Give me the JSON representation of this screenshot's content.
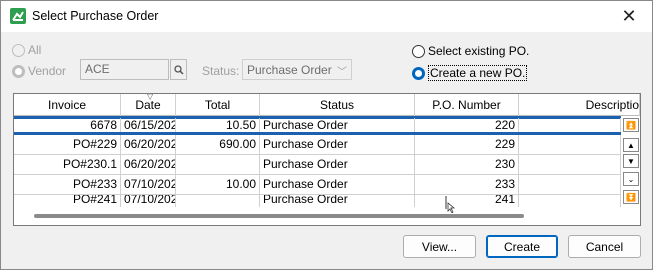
{
  "window": {
    "title": "Select Purchase Order",
    "close_glyph": "✕"
  },
  "filters": {
    "all_label": "All",
    "vendor_label": "Vendor",
    "vendor_value": "ACE",
    "status_label": "Status:",
    "status_value": "Purchase Order"
  },
  "mode": {
    "existing_label": "Select existing PO.",
    "create_label": "Create a new PO.",
    "selected": "create"
  },
  "table": {
    "columns": [
      "Invoice",
      "Date",
      "Total",
      "Status",
      "P.O. Number",
      "Descriptio"
    ],
    "rows": [
      {
        "invoice": "6678",
        "date": "06/15/202",
        "total": "10.50",
        "status": "Purchase Order",
        "po": "220"
      },
      {
        "invoice": "PO#229",
        "date": "06/20/202",
        "total": "690.00",
        "status": "Purchase Order",
        "po": "229"
      },
      {
        "invoice": "PO#230.1",
        "date": "06/20/202",
        "total": "",
        "status": "Purchase Order",
        "po": "230"
      },
      {
        "invoice": "PO#233",
        "date": "07/10/202",
        "total": "10.00",
        "status": "Purchase Order",
        "po": "233"
      },
      {
        "invoice": "PO#241",
        "date": "07/10/202",
        "total": "",
        "status": "Purchase Order",
        "po": "241"
      }
    ]
  },
  "buttons": {
    "view": "View...",
    "create": "Create",
    "cancel": "Cancel"
  },
  "colors": {
    "accent": "#0067c0",
    "selection": "#1a62b0"
  }
}
